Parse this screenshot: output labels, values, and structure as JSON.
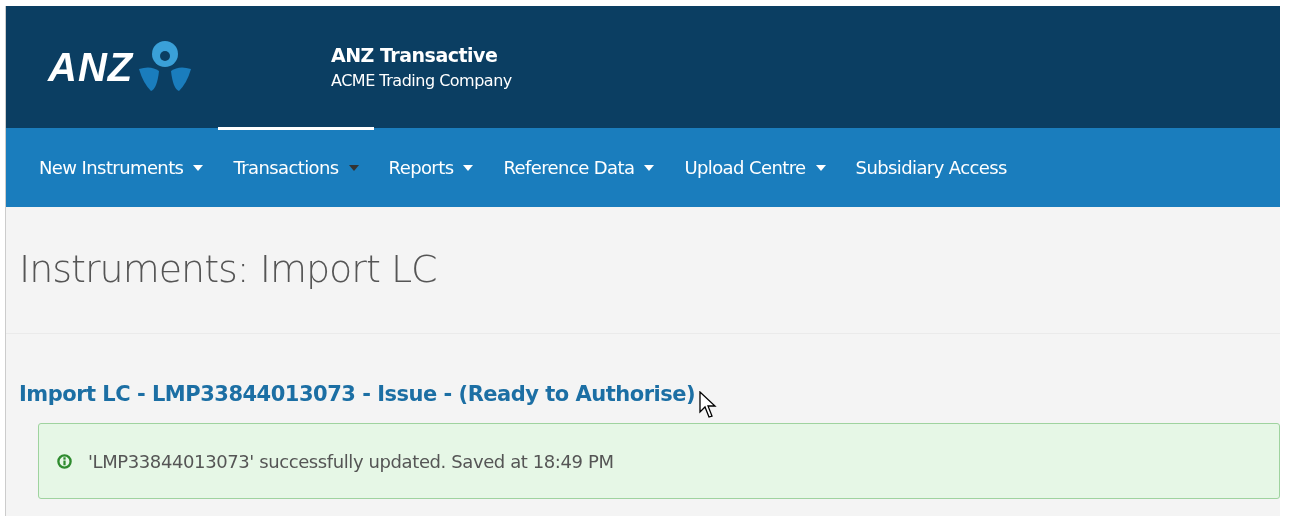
{
  "header": {
    "logo_text": "ANZ",
    "app_title": "ANZ Transactive",
    "company": "ACME Trading Company"
  },
  "nav": [
    {
      "label": "New Instruments",
      "dropdown": true,
      "selected": false
    },
    {
      "label": "Transactions",
      "dropdown": true,
      "selected": true
    },
    {
      "label": "Reports",
      "dropdown": true,
      "selected": false
    },
    {
      "label": "Reference Data",
      "dropdown": true,
      "selected": false
    },
    {
      "label": "Upload Centre",
      "dropdown": true,
      "selected": false
    },
    {
      "label": "Subsidiary Access",
      "dropdown": false,
      "selected": false
    }
  ],
  "page_title": "Instruments: Import LC",
  "record_heading": "Import LC - LMP33844013073 - Issue - (Ready to Authorise)",
  "alert": {
    "message": "'LMP33844013073' successfully updated. Saved at 18:49 PM"
  }
}
